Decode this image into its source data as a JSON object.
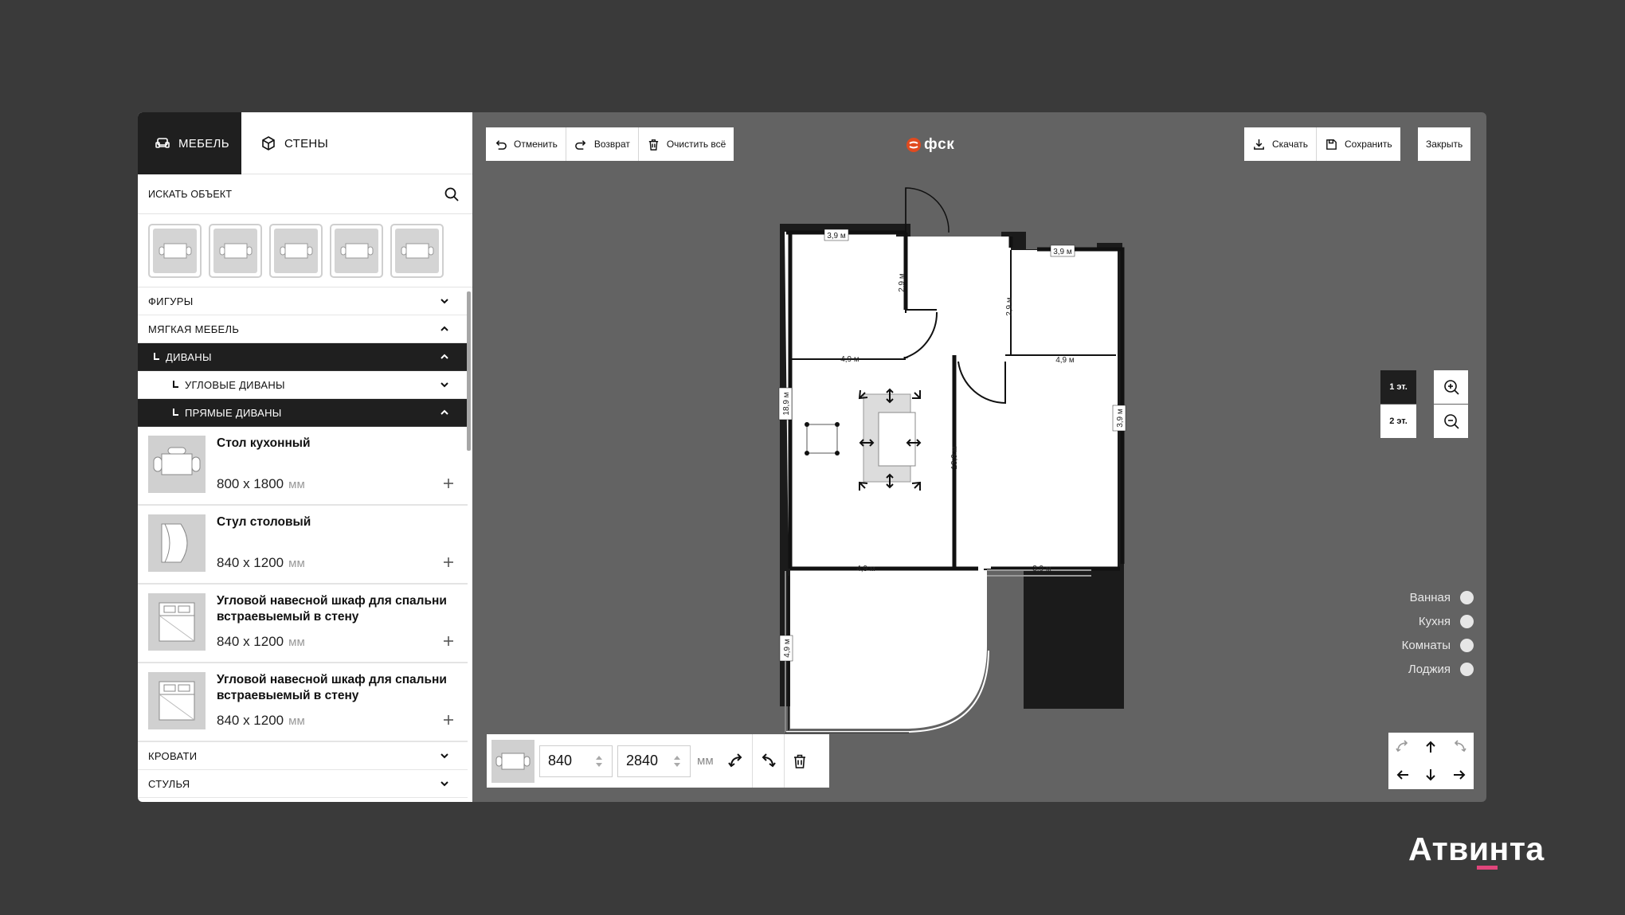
{
  "tabs": {
    "furniture": "МЕБЕЛЬ",
    "walls": "СТЕНЫ"
  },
  "search": {
    "label": "ИСКАТЬ ОБЪЕКТ"
  },
  "categories": {
    "figures": "ФИГУРЫ",
    "soft_furniture": "МЯГКАЯ МЕБЕЛЬ",
    "sofas": "ДИВАНЫ",
    "corner_sofas": "УГЛОВЫЕ ДИВАНЫ",
    "straight_sofas": "ПРЯМЫЕ ДИВАНЫ",
    "beds": "КРОВАТИ",
    "chairs": "СТУЛЬЯ"
  },
  "items": [
    {
      "name": "Стол кухонный",
      "dims": "800 х 1800",
      "unit": "мм"
    },
    {
      "name": "Стул столовый",
      "dims": "840 х 1200",
      "unit": "мм"
    },
    {
      "name": "Угловой навесной шкаф для спальни встраевыемый в стену",
      "dims": "840 х 1200",
      "unit": "мм"
    },
    {
      "name": "Угловой навесной шкаф для спальни встраевыемый в стену",
      "dims": "840 х 1200",
      "unit": "мм"
    }
  ],
  "toolbar": {
    "undo": "Отменить",
    "redo": "Возврат",
    "clear": "Очистить всё",
    "download": "Скачать",
    "save": "Сохранить",
    "close": "Закрыть"
  },
  "logo": "фск",
  "floors": {
    "first": "1 эт.",
    "second": "2 эт."
  },
  "legend": [
    "Ванная",
    "Кухня",
    "Комнаты",
    "Лоджия"
  ],
  "editbar": {
    "width": "840",
    "height": "2840",
    "unit": "мм"
  },
  "plan": {
    "dims": {
      "top_left": "3,9 м",
      "top_right": "3,9 м",
      "v_corridor": "2,9 м",
      "v_mid": "2,9 м",
      "room_left": "4,9 м",
      "room_right": "4,9 м",
      "left_side": "18,9 м",
      "right_side": "3,9 м",
      "partition": "13,9 м",
      "bottom_left": "4,9 м",
      "bottom_right": "3,9 м",
      "loggia": "4,9 м"
    }
  },
  "brand": "Атвинта",
  "colors": {
    "panel_dark": "#1f1f1f",
    "canvas": "#636363",
    "background": "#3a3a3a",
    "logo_accent": "#e04a1f",
    "brand_accent": "#e0457b"
  }
}
